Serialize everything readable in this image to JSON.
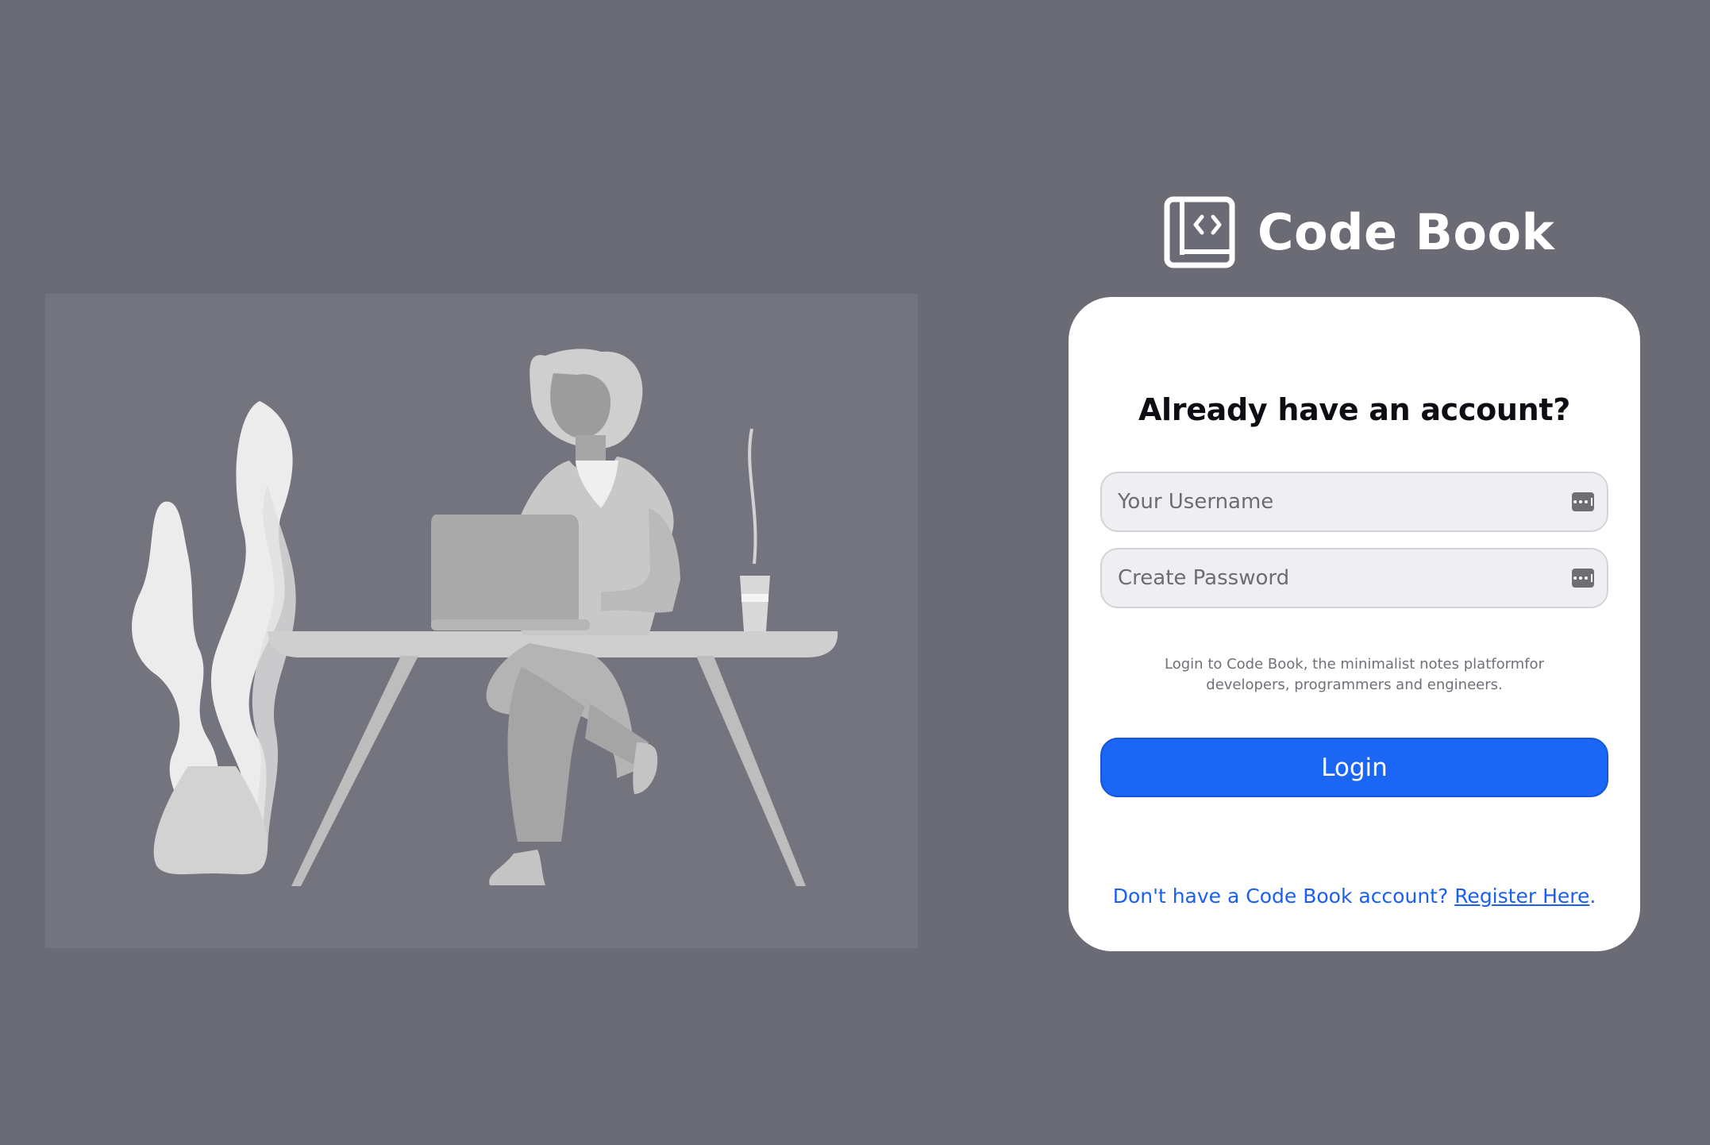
{
  "brand": {
    "name": "Code Book",
    "logo_icon": "code-book-icon"
  },
  "illustration": {
    "icon": "person-at-desk-illustration"
  },
  "login_card": {
    "title": "Already have an account?",
    "username_placeholder": "Your Username",
    "password_placeholder": "Create Password",
    "field_icon": "password-manager-icon",
    "tagline": "Login to Code Book, the minimalist notes platformfor developers, programmers and engineers.",
    "login_label": "Login",
    "register_prompt": "Don't have a Code Book account? ",
    "register_link": "Register Here",
    "register_suffix": "."
  },
  "colors": {
    "background": "#6b6b76",
    "primary": "#1b66f5",
    "link": "#1b5ff0",
    "card": "#ffffff"
  }
}
